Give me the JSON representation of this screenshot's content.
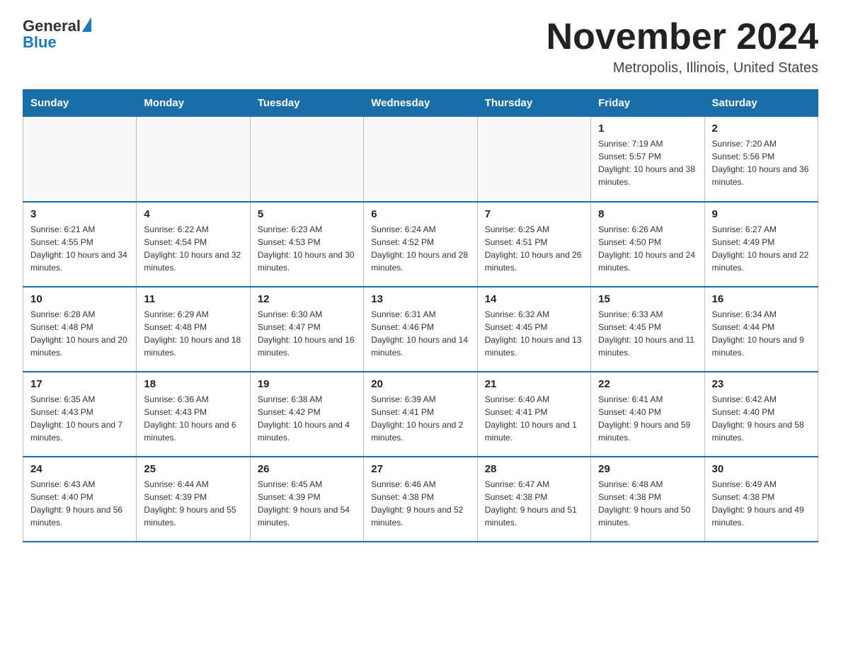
{
  "header": {
    "logo_text_general": "General",
    "logo_text_blue": "Blue",
    "month_title": "November 2024",
    "location": "Metropolis, Illinois, United States"
  },
  "days_of_week": [
    "Sunday",
    "Monday",
    "Tuesday",
    "Wednesday",
    "Thursday",
    "Friday",
    "Saturday"
  ],
  "weeks": [
    [
      {
        "day": "",
        "info": ""
      },
      {
        "day": "",
        "info": ""
      },
      {
        "day": "",
        "info": ""
      },
      {
        "day": "",
        "info": ""
      },
      {
        "day": "",
        "info": ""
      },
      {
        "day": "1",
        "info": "Sunrise: 7:19 AM\nSunset: 5:57 PM\nDaylight: 10 hours and 38 minutes."
      },
      {
        "day": "2",
        "info": "Sunrise: 7:20 AM\nSunset: 5:56 PM\nDaylight: 10 hours and 36 minutes."
      }
    ],
    [
      {
        "day": "3",
        "info": "Sunrise: 6:21 AM\nSunset: 4:55 PM\nDaylight: 10 hours and 34 minutes."
      },
      {
        "day": "4",
        "info": "Sunrise: 6:22 AM\nSunset: 4:54 PM\nDaylight: 10 hours and 32 minutes."
      },
      {
        "day": "5",
        "info": "Sunrise: 6:23 AM\nSunset: 4:53 PM\nDaylight: 10 hours and 30 minutes."
      },
      {
        "day": "6",
        "info": "Sunrise: 6:24 AM\nSunset: 4:52 PM\nDaylight: 10 hours and 28 minutes."
      },
      {
        "day": "7",
        "info": "Sunrise: 6:25 AM\nSunset: 4:51 PM\nDaylight: 10 hours and 26 minutes."
      },
      {
        "day": "8",
        "info": "Sunrise: 6:26 AM\nSunset: 4:50 PM\nDaylight: 10 hours and 24 minutes."
      },
      {
        "day": "9",
        "info": "Sunrise: 6:27 AM\nSunset: 4:49 PM\nDaylight: 10 hours and 22 minutes."
      }
    ],
    [
      {
        "day": "10",
        "info": "Sunrise: 6:28 AM\nSunset: 4:48 PM\nDaylight: 10 hours and 20 minutes."
      },
      {
        "day": "11",
        "info": "Sunrise: 6:29 AM\nSunset: 4:48 PM\nDaylight: 10 hours and 18 minutes."
      },
      {
        "day": "12",
        "info": "Sunrise: 6:30 AM\nSunset: 4:47 PM\nDaylight: 10 hours and 16 minutes."
      },
      {
        "day": "13",
        "info": "Sunrise: 6:31 AM\nSunset: 4:46 PM\nDaylight: 10 hours and 14 minutes."
      },
      {
        "day": "14",
        "info": "Sunrise: 6:32 AM\nSunset: 4:45 PM\nDaylight: 10 hours and 13 minutes."
      },
      {
        "day": "15",
        "info": "Sunrise: 6:33 AM\nSunset: 4:45 PM\nDaylight: 10 hours and 11 minutes."
      },
      {
        "day": "16",
        "info": "Sunrise: 6:34 AM\nSunset: 4:44 PM\nDaylight: 10 hours and 9 minutes."
      }
    ],
    [
      {
        "day": "17",
        "info": "Sunrise: 6:35 AM\nSunset: 4:43 PM\nDaylight: 10 hours and 7 minutes."
      },
      {
        "day": "18",
        "info": "Sunrise: 6:36 AM\nSunset: 4:43 PM\nDaylight: 10 hours and 6 minutes."
      },
      {
        "day": "19",
        "info": "Sunrise: 6:38 AM\nSunset: 4:42 PM\nDaylight: 10 hours and 4 minutes."
      },
      {
        "day": "20",
        "info": "Sunrise: 6:39 AM\nSunset: 4:41 PM\nDaylight: 10 hours and 2 minutes."
      },
      {
        "day": "21",
        "info": "Sunrise: 6:40 AM\nSunset: 4:41 PM\nDaylight: 10 hours and 1 minute."
      },
      {
        "day": "22",
        "info": "Sunrise: 6:41 AM\nSunset: 4:40 PM\nDaylight: 9 hours and 59 minutes."
      },
      {
        "day": "23",
        "info": "Sunrise: 6:42 AM\nSunset: 4:40 PM\nDaylight: 9 hours and 58 minutes."
      }
    ],
    [
      {
        "day": "24",
        "info": "Sunrise: 6:43 AM\nSunset: 4:40 PM\nDaylight: 9 hours and 56 minutes."
      },
      {
        "day": "25",
        "info": "Sunrise: 6:44 AM\nSunset: 4:39 PM\nDaylight: 9 hours and 55 minutes."
      },
      {
        "day": "26",
        "info": "Sunrise: 6:45 AM\nSunset: 4:39 PM\nDaylight: 9 hours and 54 minutes."
      },
      {
        "day": "27",
        "info": "Sunrise: 6:46 AM\nSunset: 4:38 PM\nDaylight: 9 hours and 52 minutes."
      },
      {
        "day": "28",
        "info": "Sunrise: 6:47 AM\nSunset: 4:38 PM\nDaylight: 9 hours and 51 minutes."
      },
      {
        "day": "29",
        "info": "Sunrise: 6:48 AM\nSunset: 4:38 PM\nDaylight: 9 hours and 50 minutes."
      },
      {
        "day": "30",
        "info": "Sunrise: 6:49 AM\nSunset: 4:38 PM\nDaylight: 9 hours and 49 minutes."
      }
    ]
  ]
}
